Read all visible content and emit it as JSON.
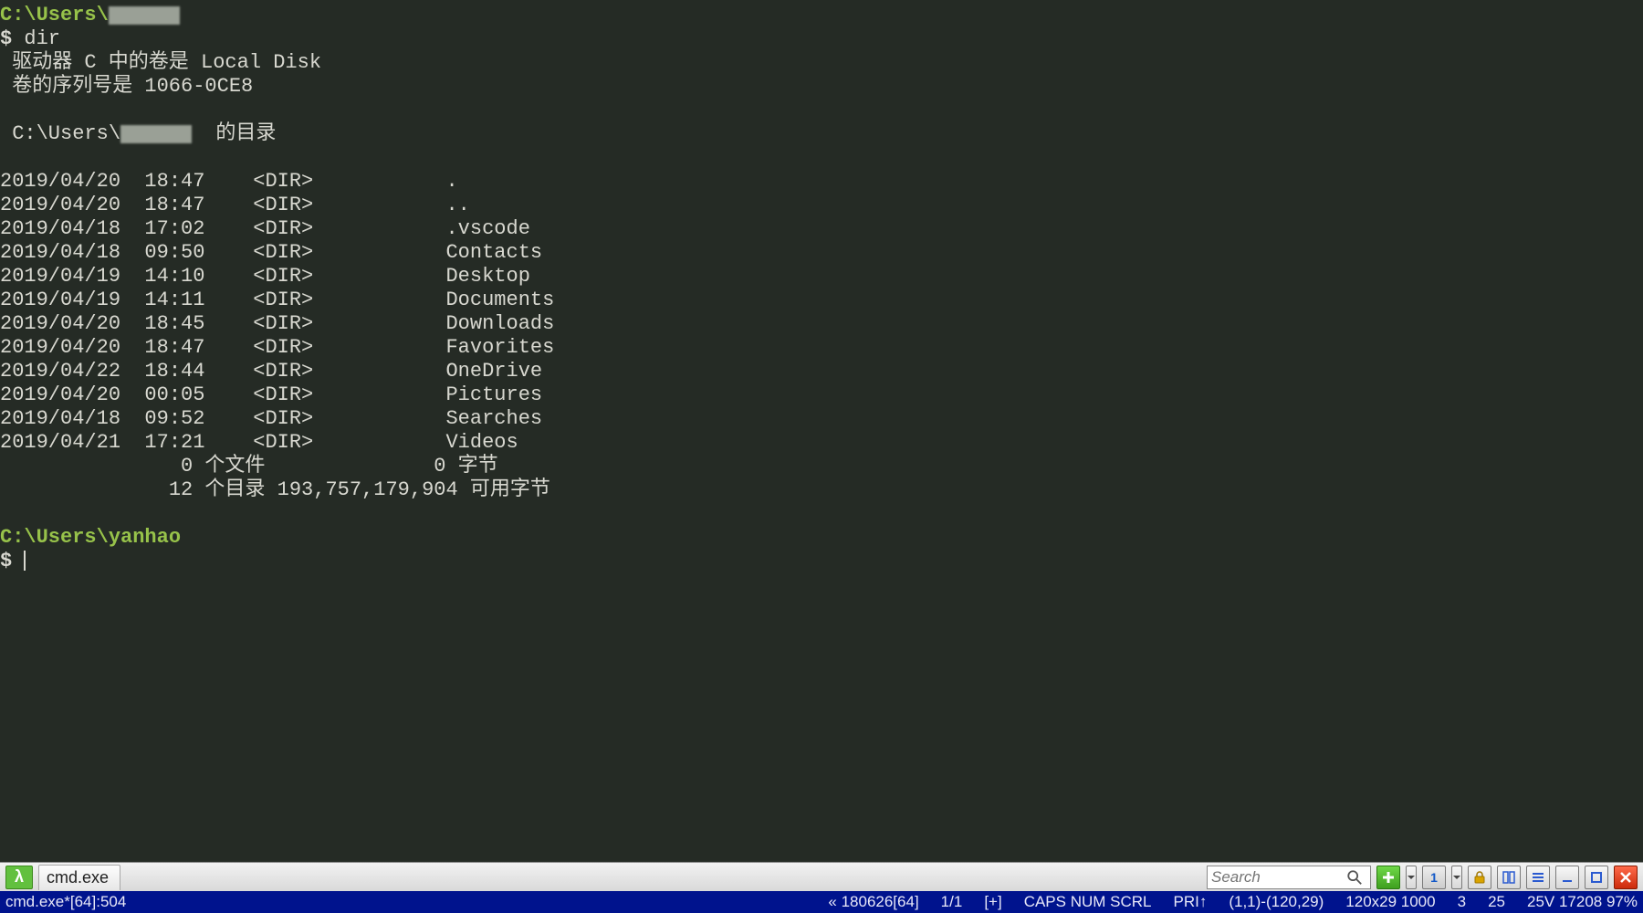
{
  "prompt1": {
    "path": "C:\\Users\\",
    "sigil": "$",
    "cmd": "dir"
  },
  "vol_line": " 驱动器 C 中的卷是 Local Disk",
  "serial_line": " 卷的序列号是 1066-0CE8",
  "dir_of_prefix": " C:\\Users\\",
  "dir_of_suffix": "  的目录",
  "entries": [
    {
      "date": "2019/04/20",
      "time": "18:47",
      "type": "<DIR>",
      "name": "."
    },
    {
      "date": "2019/04/20",
      "time": "18:47",
      "type": "<DIR>",
      "name": ".."
    },
    {
      "date": "2019/04/18",
      "time": "17:02",
      "type": "<DIR>",
      "name": ".vscode"
    },
    {
      "date": "2019/04/18",
      "time": "09:50",
      "type": "<DIR>",
      "name": "Contacts"
    },
    {
      "date": "2019/04/19",
      "time": "14:10",
      "type": "<DIR>",
      "name": "Desktop"
    },
    {
      "date": "2019/04/19",
      "time": "14:11",
      "type": "<DIR>",
      "name": "Documents"
    },
    {
      "date": "2019/04/20",
      "time": "18:45",
      "type": "<DIR>",
      "name": "Downloads"
    },
    {
      "date": "2019/04/20",
      "time": "18:47",
      "type": "<DIR>",
      "name": "Favorites"
    },
    {
      "date": "2019/04/22",
      "time": "18:44",
      "type": "<DIR>",
      "name": "OneDrive"
    },
    {
      "date": "2019/04/20",
      "time": "00:05",
      "type": "<DIR>",
      "name": "Pictures"
    },
    {
      "date": "2019/04/18",
      "time": "09:52",
      "type": "<DIR>",
      "name": "Searches"
    },
    {
      "date": "2019/04/21",
      "time": "17:21",
      "type": "<DIR>",
      "name": "Videos"
    }
  ],
  "summary_files": "               0 个文件              0 字节",
  "summary_dirs": "              12 个目录 193,757,179,904 可用字节",
  "prompt2": {
    "path": "C:\\Users\\yanhao",
    "sigil": "$"
  },
  "toolbar": {
    "lambda": "λ",
    "tab_label": "cmd.exe",
    "search_placeholder": "Search"
  },
  "status": {
    "left": "cmd.exe*[64]:504",
    "chunk": "« 180626[64]",
    "ratio": "1/1",
    "plus": "[+]",
    "caps": "CAPS NUM SCRL",
    "pri": "PRI↑",
    "sel": "(1,1)-(120,29)",
    "size": "120x29 1000",
    "three": "3",
    "twentyfive": "25",
    "mem": "25V 17208 97%"
  }
}
